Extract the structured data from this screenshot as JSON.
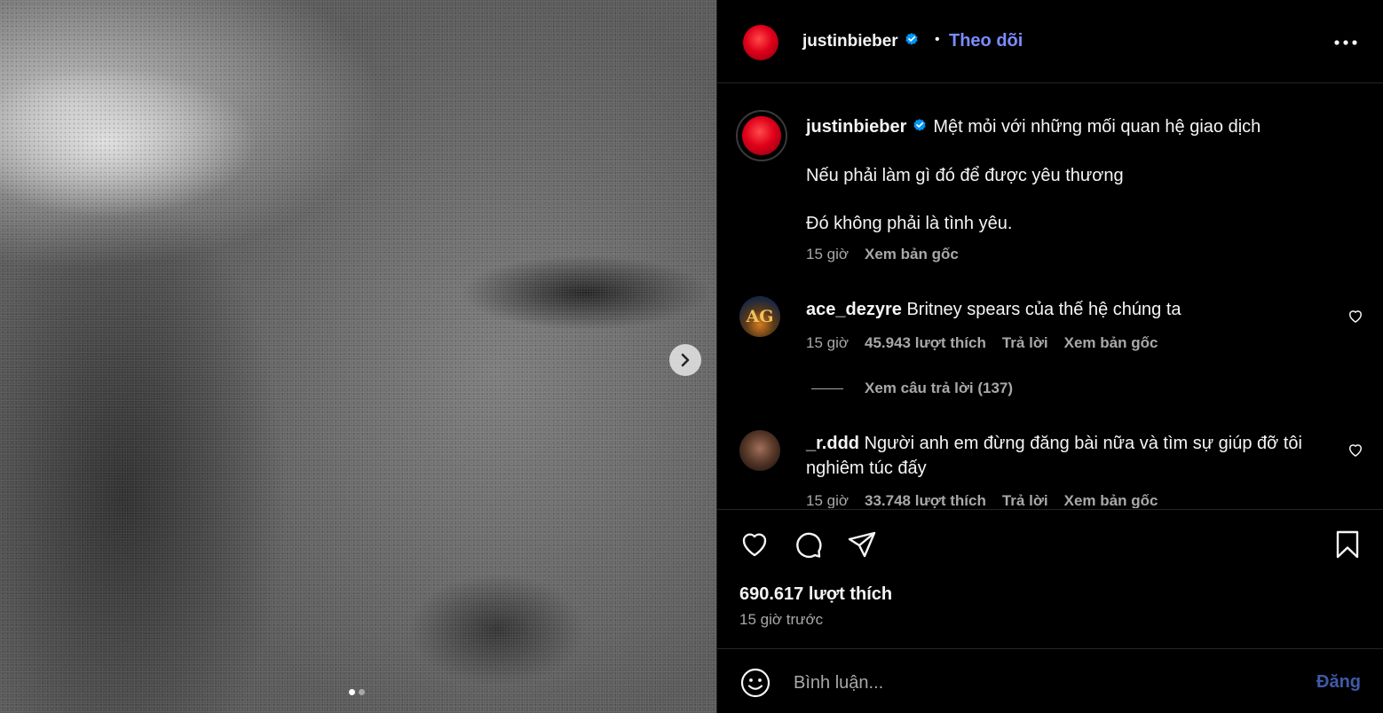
{
  "post": {
    "author": "justinbieber",
    "follow_label": "Theo dõi",
    "bullet": "•",
    "caption_lines": [
      "Mệt mỏi với những mối quan hệ giao dịch",
      "Nếu phải làm gì đó để được yêu thương",
      "Đó không phải là tình yêu."
    ],
    "caption_time": "15 giờ",
    "caption_translate": "Xem bản gốc",
    "photo_description_icon": "media-photo",
    "carousel": {
      "current": 1,
      "total": 2
    }
  },
  "comments": [
    {
      "username": "ace_dezyre",
      "text": "Britney spears của thế hệ chúng ta",
      "time": "15 giờ",
      "likes": "45.943 lượt thích",
      "reply": "Trả lời",
      "translate": "Xem bản gốc",
      "avatar_text": "AG",
      "view_replies": "Xem câu trả lời (137)"
    },
    {
      "username": "_r.ddd",
      "text_line1": "Người anh em đừng đăng bài nữa và tìm sự giúp đỡ tôi",
      "text_line2": "nghiêm túc đấy",
      "time": "15 giờ",
      "likes": "33.748 lượt thích",
      "reply": "Trả lời",
      "translate": "Xem bản gốc"
    }
  ],
  "actions": {
    "likes_count": "690.617 lượt thích",
    "time_ago": "15 giờ trước"
  },
  "compose": {
    "placeholder": "Bình luận...",
    "post_label": "Đăng"
  },
  "colors": {
    "accent_link": "#7c8cff",
    "verified": "#0095f6",
    "post_disabled": "#3e5aa8",
    "muted_text": "#a8a8a8"
  },
  "icons": [
    "chevron-right-icon",
    "verified-badge-icon",
    "more-options-icon",
    "heart-icon",
    "comment-icon",
    "share-icon",
    "bookmark-icon",
    "emoji-icon"
  ]
}
